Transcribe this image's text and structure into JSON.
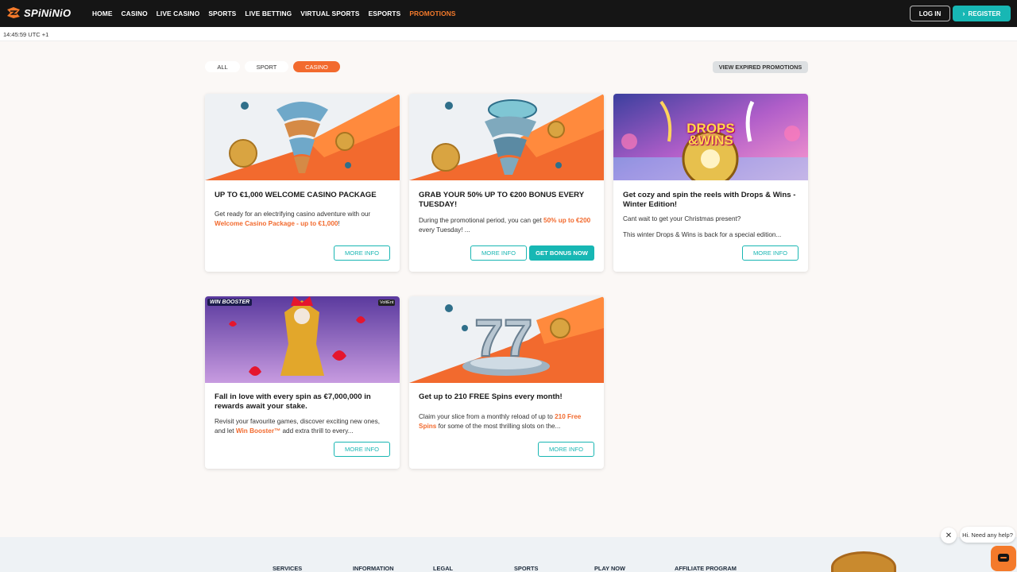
{
  "header": {
    "logo_text": "SPiNiNiO",
    "nav": [
      "HOME",
      "CASINO",
      "LIVE CASINO",
      "SPORTS",
      "LIVE BETTING",
      "VIRTUAL SPORTS",
      "ESPORTS",
      "PROMOTIONS"
    ],
    "active_nav": "PROMOTIONS",
    "login_label": "LOG IN",
    "register_label": "REGISTER"
  },
  "time": "14:45:59 UTC +1",
  "filters": {
    "all": "ALL",
    "sport": "SPORT",
    "casino": "CASINO",
    "active": "CASINO",
    "expired_label": "VIEW EXPIRED PROMOTIONS"
  },
  "cards": [
    {
      "title": "UP TO €1,000 WELCOME CASINO PACKAGE",
      "text_before": "Get ready for an electrifying casino adventure with our ",
      "highlight": "Welcome Casino Package - up to €1,000",
      "text_after": "!",
      "more_label": "MORE INFO"
    },
    {
      "title": "GRAB YOUR 50% UP TO €200 BONUS EVERY TUESDAY!",
      "text_before": "During the promotional period, you can get ",
      "highlight": "50% up to €200",
      "text_after": " every Tuesday! ...",
      "more_label": "MORE INFO",
      "bonus_label": "GET BONUS NOW"
    },
    {
      "title": "Get cozy and spin the reels with Drops & Wins - Winter Edition!",
      "line1": "Cant wait to get your Christmas present?",
      "line2": "This winter Drops & Wins is back for a special edition...",
      "more_label": "MORE INFO",
      "image_text": "DROPS &WINS"
    },
    {
      "title": "Fall in love with every spin as €7,000,000 in rewards await your stake.",
      "text_before": "Revisit your favourite games, discover exciting new ones, and let ",
      "highlight": "Win Booster™",
      "text_after": " add extra thrill to every...",
      "more_label": "MORE INFO",
      "image_badge": "WIN BOOSTER",
      "image_badge2": "VoltEnt"
    },
    {
      "title": "Get up to 210 FREE Spins every month!",
      "text_before": "Claim your slice from a monthly reload of up to ",
      "highlight": "210 Free Spins",
      "text_after": " for some of the most thrilling slots on the...",
      "more_label": "MORE INFO"
    }
  ],
  "footer": {
    "links": [
      "SERVICES",
      "INFORMATION",
      "LEGAL",
      "SPORTS",
      "PLAY NOW",
      "AFFILIATE PROGRAM"
    ]
  },
  "chat": {
    "prompt": "Hi. Need any help?"
  },
  "colors": {
    "accent_orange": "#f26a2e",
    "teal": "#17b7b4",
    "header_bg": "#151515"
  }
}
